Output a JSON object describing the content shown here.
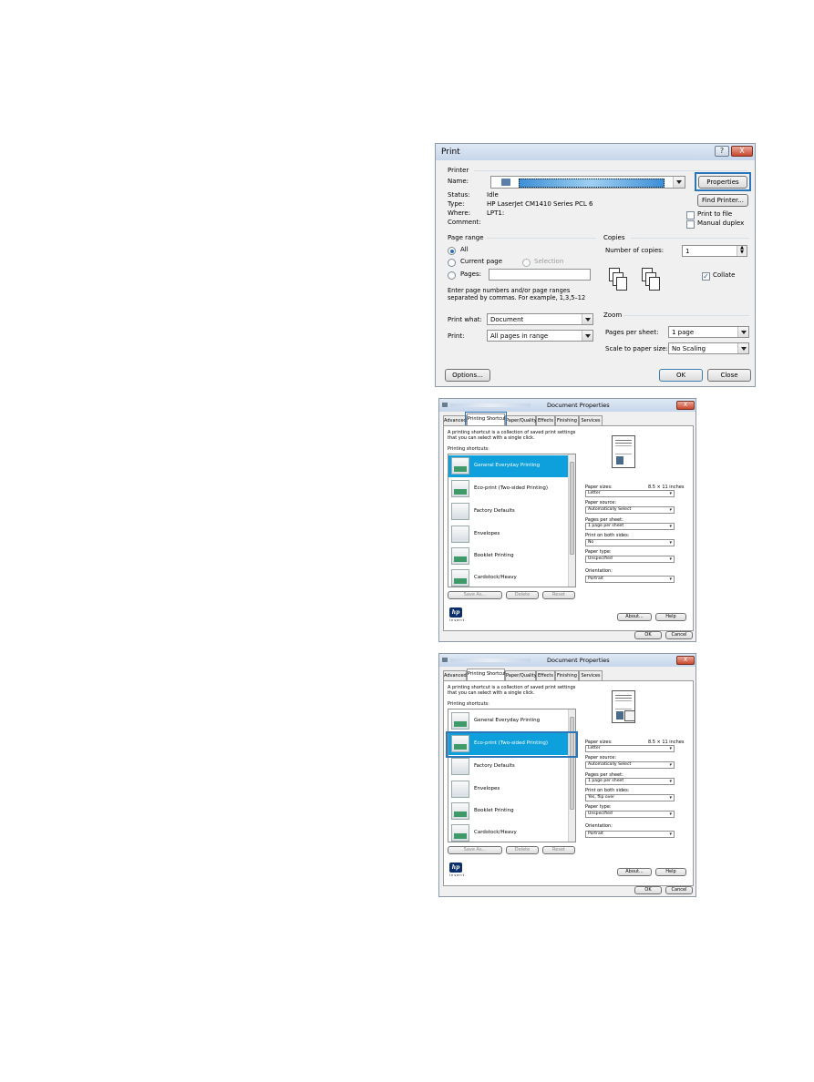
{
  "print_dialog": {
    "title": "Print",
    "help_glyph": "?",
    "close_glyph": "X",
    "printer_group": "Printer",
    "name_label": "Name:",
    "properties_button": "Properties",
    "status_label": "Status:",
    "status_value": "Idle",
    "type_label": "Type:",
    "type_value": "HP LaserJet CM1410 Series PCL 6",
    "where_label": "Where:",
    "where_value": "LPT1:",
    "comment_label": "Comment:",
    "find_printer_button": "Find Printer...",
    "print_to_file": "Print to file",
    "manual_duplex": "Manual duplex",
    "page_range_group": "Page range",
    "all_label": "All",
    "current_page_label": "Current page",
    "selection_label": "Selection",
    "pages_label": "Pages:",
    "pages_hint": "Enter page numbers and/or page ranges separated by commas. For example, 1,3,5–12",
    "copies_group": "Copies",
    "number_of_copies_label": "Number of copies:",
    "copies_value": "1",
    "collate_label": "Collate",
    "print_what_label": "Print what:",
    "print_what_value": "Document",
    "print_label": "Print:",
    "print_value": "All pages in range",
    "zoom_group": "Zoom",
    "pages_per_sheet_label": "Pages per sheet:",
    "pages_per_sheet_value": "1 page",
    "scale_label": "Scale to paper size:",
    "scale_value": "No Scaling",
    "options_button": "Options...",
    "ok_button": "OK",
    "close_button": "Close"
  },
  "properties_dialog": {
    "title": "Document Properties",
    "close_glyph": "X",
    "tabs": [
      "Advanced",
      "Printing Shortcuts",
      "Paper/Quality",
      "Effects",
      "Finishing",
      "Services"
    ],
    "description": "A printing shortcut is a collection of saved print settings that you can select with a single click.",
    "shortcuts_label": "Printing shortcuts:",
    "shortcuts": [
      "General Everyday Printing",
      "Eco-print (Two-sided Printing)",
      "Factory Defaults",
      "Envelopes",
      "Booklet Printing",
      "Cardstock/Heavy"
    ],
    "paper_sizes_label": "Paper sizes:",
    "paper_sizes_dim": "8.5 × 11 inches",
    "paper_size_value": "Letter",
    "paper_source_label": "Paper source:",
    "paper_source_value": "Automatically Select",
    "pages_per_sheet_label": "Pages per sheet:",
    "pages_per_sheet_value": "1 page per sheet",
    "both_sides_label": "Print on both sides:",
    "paper_type_label": "Paper type:",
    "paper_type_value": "Unspecified",
    "orientation_label": "Orientation:",
    "orientation_value": "Portrait",
    "save_as_button": "Save As...",
    "delete_button": "Delete",
    "reset_button": "Reset",
    "about_button": "About...",
    "help_button": "Help",
    "ok_button": "OK",
    "cancel_button": "Cancel",
    "logo_text": "hp",
    "logo_caption": "invent"
  },
  "props1": {
    "both_sides_value": "No"
  },
  "props2": {
    "both_sides_value": "Yes, flip over"
  },
  "colors": {
    "selection": "#0ea0dc",
    "highlight": "#2a76b8"
  }
}
